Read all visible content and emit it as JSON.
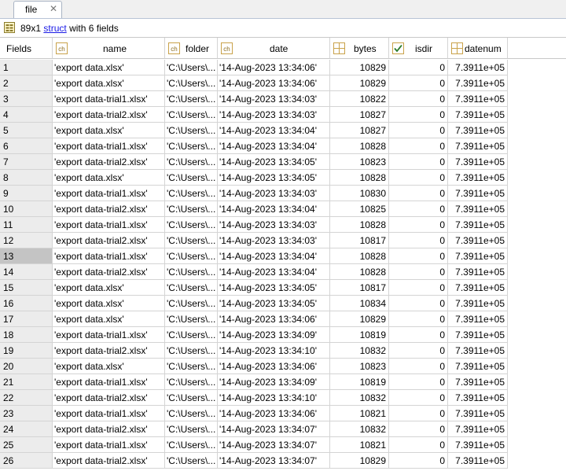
{
  "tab": {
    "label": "file",
    "close": "✕"
  },
  "info": {
    "size": "89x1",
    "link": "struct",
    "rest": "with 6 fields"
  },
  "columns": [
    {
      "key": "fields",
      "label": "Fields",
      "icon": "none"
    },
    {
      "key": "name",
      "label": "name",
      "icon": "char-icon"
    },
    {
      "key": "folder",
      "label": "folder",
      "icon": "char-icon"
    },
    {
      "key": "date",
      "label": "date",
      "icon": "char-icon"
    },
    {
      "key": "bytes",
      "label": "bytes",
      "icon": "numeric-icon"
    },
    {
      "key": "isdir",
      "label": "isdir",
      "icon": "logical-icon"
    },
    {
      "key": "datenum",
      "label": "datenum",
      "icon": "numeric-icon"
    }
  ],
  "selected_row": 13,
  "rows": [
    {
      "idx": "1",
      "name": "'export data.xlsx'",
      "folder": "'C:\\Users\\...",
      "date": "'14-Aug-2023 13:34:06'",
      "bytes": "10829",
      "isdir": "0",
      "datenum": "7.3911e+05"
    },
    {
      "idx": "2",
      "name": "'export data.xlsx'",
      "folder": "'C:\\Users\\...",
      "date": "'14-Aug-2023 13:34:06'",
      "bytes": "10829",
      "isdir": "0",
      "datenum": "7.3911e+05"
    },
    {
      "idx": "3",
      "name": "'export data-trial1.xlsx'",
      "folder": "'C:\\Users\\...",
      "date": "'14-Aug-2023 13:34:03'",
      "bytes": "10822",
      "isdir": "0",
      "datenum": "7.3911e+05"
    },
    {
      "idx": "4",
      "name": "'export data-trial2.xlsx'",
      "folder": "'C:\\Users\\...",
      "date": "'14-Aug-2023 13:34:03'",
      "bytes": "10827",
      "isdir": "0",
      "datenum": "7.3911e+05"
    },
    {
      "idx": "5",
      "name": "'export data.xlsx'",
      "folder": "'C:\\Users\\...",
      "date": "'14-Aug-2023 13:34:04'",
      "bytes": "10827",
      "isdir": "0",
      "datenum": "7.3911e+05"
    },
    {
      "idx": "6",
      "name": "'export data-trial1.xlsx'",
      "folder": "'C:\\Users\\...",
      "date": "'14-Aug-2023 13:34:04'",
      "bytes": "10828",
      "isdir": "0",
      "datenum": "7.3911e+05"
    },
    {
      "idx": "7",
      "name": "'export data-trial2.xlsx'",
      "folder": "'C:\\Users\\...",
      "date": "'14-Aug-2023 13:34:05'",
      "bytes": "10823",
      "isdir": "0",
      "datenum": "7.3911e+05"
    },
    {
      "idx": "8",
      "name": "'export data.xlsx'",
      "folder": "'C:\\Users\\...",
      "date": "'14-Aug-2023 13:34:05'",
      "bytes": "10828",
      "isdir": "0",
      "datenum": "7.3911e+05"
    },
    {
      "idx": "9",
      "name": "'export data-trial1.xlsx'",
      "folder": "'C:\\Users\\...",
      "date": "'14-Aug-2023 13:34:03'",
      "bytes": "10830",
      "isdir": "0",
      "datenum": "7.3911e+05"
    },
    {
      "idx": "10",
      "name": "'export data-trial2.xlsx'",
      "folder": "'C:\\Users\\...",
      "date": "'14-Aug-2023 13:34:04'",
      "bytes": "10825",
      "isdir": "0",
      "datenum": "7.3911e+05"
    },
    {
      "idx": "11",
      "name": "'export data-trial1.xlsx'",
      "folder": "'C:\\Users\\...",
      "date": "'14-Aug-2023 13:34:03'",
      "bytes": "10828",
      "isdir": "0",
      "datenum": "7.3911e+05"
    },
    {
      "idx": "12",
      "name": "'export data-trial2.xlsx'",
      "folder": "'C:\\Users\\...",
      "date": "'14-Aug-2023 13:34:03'",
      "bytes": "10817",
      "isdir": "0",
      "datenum": "7.3911e+05"
    },
    {
      "idx": "13",
      "name": "'export data-trial1.xlsx'",
      "folder": "'C:\\Users\\...",
      "date": "'14-Aug-2023 13:34:04'",
      "bytes": "10828",
      "isdir": "0",
      "datenum": "7.3911e+05"
    },
    {
      "idx": "14",
      "name": "'export data-trial2.xlsx'",
      "folder": "'C:\\Users\\...",
      "date": "'14-Aug-2023 13:34:04'",
      "bytes": "10828",
      "isdir": "0",
      "datenum": "7.3911e+05"
    },
    {
      "idx": "15",
      "name": "'export data.xlsx'",
      "folder": "'C:\\Users\\...",
      "date": "'14-Aug-2023 13:34:05'",
      "bytes": "10817",
      "isdir": "0",
      "datenum": "7.3911e+05"
    },
    {
      "idx": "16",
      "name": "'export data.xlsx'",
      "folder": "'C:\\Users\\...",
      "date": "'14-Aug-2023 13:34:05'",
      "bytes": "10834",
      "isdir": "0",
      "datenum": "7.3911e+05"
    },
    {
      "idx": "17",
      "name": "'export data.xlsx'",
      "folder": "'C:\\Users\\...",
      "date": "'14-Aug-2023 13:34:06'",
      "bytes": "10829",
      "isdir": "0",
      "datenum": "7.3911e+05"
    },
    {
      "idx": "18",
      "name": "'export data-trial1.xlsx'",
      "folder": "'C:\\Users\\...",
      "date": "'14-Aug-2023 13:34:09'",
      "bytes": "10819",
      "isdir": "0",
      "datenum": "7.3911e+05"
    },
    {
      "idx": "19",
      "name": "'export data-trial2.xlsx'",
      "folder": "'C:\\Users\\...",
      "date": "'14-Aug-2023 13:34:10'",
      "bytes": "10832",
      "isdir": "0",
      "datenum": "7.3911e+05"
    },
    {
      "idx": "20",
      "name": "'export data.xlsx'",
      "folder": "'C:\\Users\\...",
      "date": "'14-Aug-2023 13:34:06'",
      "bytes": "10823",
      "isdir": "0",
      "datenum": "7.3911e+05"
    },
    {
      "idx": "21",
      "name": "'export data-trial1.xlsx'",
      "folder": "'C:\\Users\\...",
      "date": "'14-Aug-2023 13:34:09'",
      "bytes": "10819",
      "isdir": "0",
      "datenum": "7.3911e+05"
    },
    {
      "idx": "22",
      "name": "'export data-trial2.xlsx'",
      "folder": "'C:\\Users\\...",
      "date": "'14-Aug-2023 13:34:10'",
      "bytes": "10832",
      "isdir": "0",
      "datenum": "7.3911e+05"
    },
    {
      "idx": "23",
      "name": "'export data-trial1.xlsx'",
      "folder": "'C:\\Users\\...",
      "date": "'14-Aug-2023 13:34:06'",
      "bytes": "10821",
      "isdir": "0",
      "datenum": "7.3911e+05"
    },
    {
      "idx": "24",
      "name": "'export data-trial2.xlsx'",
      "folder": "'C:\\Users\\...",
      "date": "'14-Aug-2023 13:34:07'",
      "bytes": "10832",
      "isdir": "0",
      "datenum": "7.3911e+05"
    },
    {
      "idx": "25",
      "name": "'export data-trial1.xlsx'",
      "folder": "'C:\\Users\\...",
      "date": "'14-Aug-2023 13:34:07'",
      "bytes": "10821",
      "isdir": "0",
      "datenum": "7.3911e+05"
    },
    {
      "idx": "26",
      "name": "'export data-trial2.xlsx'",
      "folder": "'C:\\Users\\...",
      "date": "'14-Aug-2023 13:34:07'",
      "bytes": "10829",
      "isdir": "0",
      "datenum": "7.3911e+05"
    }
  ]
}
